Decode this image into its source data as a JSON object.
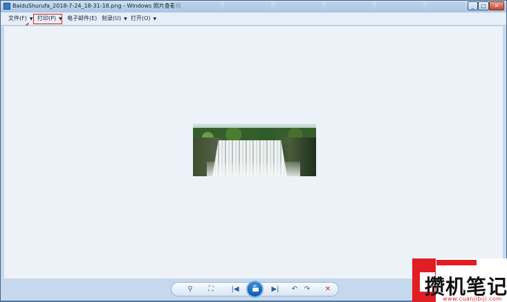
{
  "window": {
    "title": "BaiduShurufa_2018-7-24_18-31-18.png - Windows 照片查看器",
    "controls": {
      "minimize": "_",
      "maximize": "□",
      "close": "✕"
    }
  },
  "menubar": {
    "items": [
      {
        "label": "文件(F)"
      },
      {
        "label": "打印(P)"
      },
      {
        "label": "电子邮件(E)"
      },
      {
        "label": "刻录(U)"
      },
      {
        "label": "打开(O)"
      }
    ],
    "help_label": "?",
    "highlight_color": "#e02020"
  },
  "controls": {
    "zoom": "⚲",
    "actual_size": "⛶",
    "previous": "|◀",
    "next": "▶|",
    "rotate_left": "↶",
    "rotate_right": "↷",
    "delete": "✕"
  },
  "watermark": {
    "text": "攒机笔记",
    "url": "www.cuanjibiji.com"
  },
  "image_subject": "waterfall"
}
